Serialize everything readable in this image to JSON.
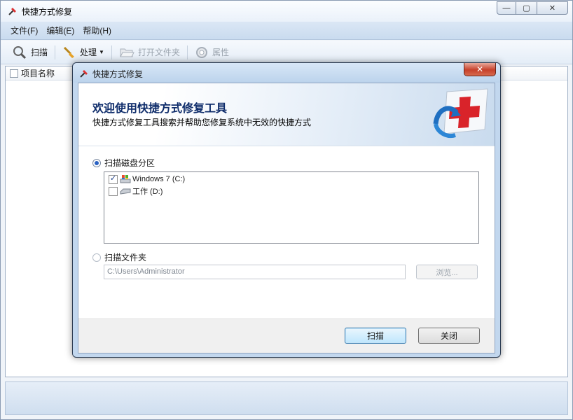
{
  "window": {
    "title": "快捷方式修复"
  },
  "window_buttons": {
    "minimize": "—",
    "restore": "▢",
    "close": "✕"
  },
  "menu": [
    "文件(F)",
    "编辑(E)",
    "帮助(H)"
  ],
  "toolbar": {
    "scan": "扫描",
    "process": "处理",
    "open_folder": "打开文件夹",
    "properties": "属性"
  },
  "list": {
    "column_name": "项目名称"
  },
  "dialog": {
    "title": "快捷方式修复",
    "close": "✕",
    "banner_title": "欢迎使用快捷方式修复工具",
    "banner_subtitle": "快捷方式修复工具搜索并帮助您修复系统中无效的快捷方式",
    "scan_partition": "扫描磁盘分区",
    "drives": [
      {
        "label": "Windows 7 (C:)",
        "checked": true
      },
      {
        "label": "工作 (D:)",
        "checked": false
      }
    ],
    "scan_folder": "扫描文件夹",
    "folder_path": "C:\\Users\\Administrator",
    "browse": "浏览...",
    "scan_button": "扫描",
    "close_button": "关闭"
  },
  "colors": {
    "accent": "#2a62c3",
    "banner_title": "#0f2d6b",
    "close_red": "#c7412a"
  }
}
